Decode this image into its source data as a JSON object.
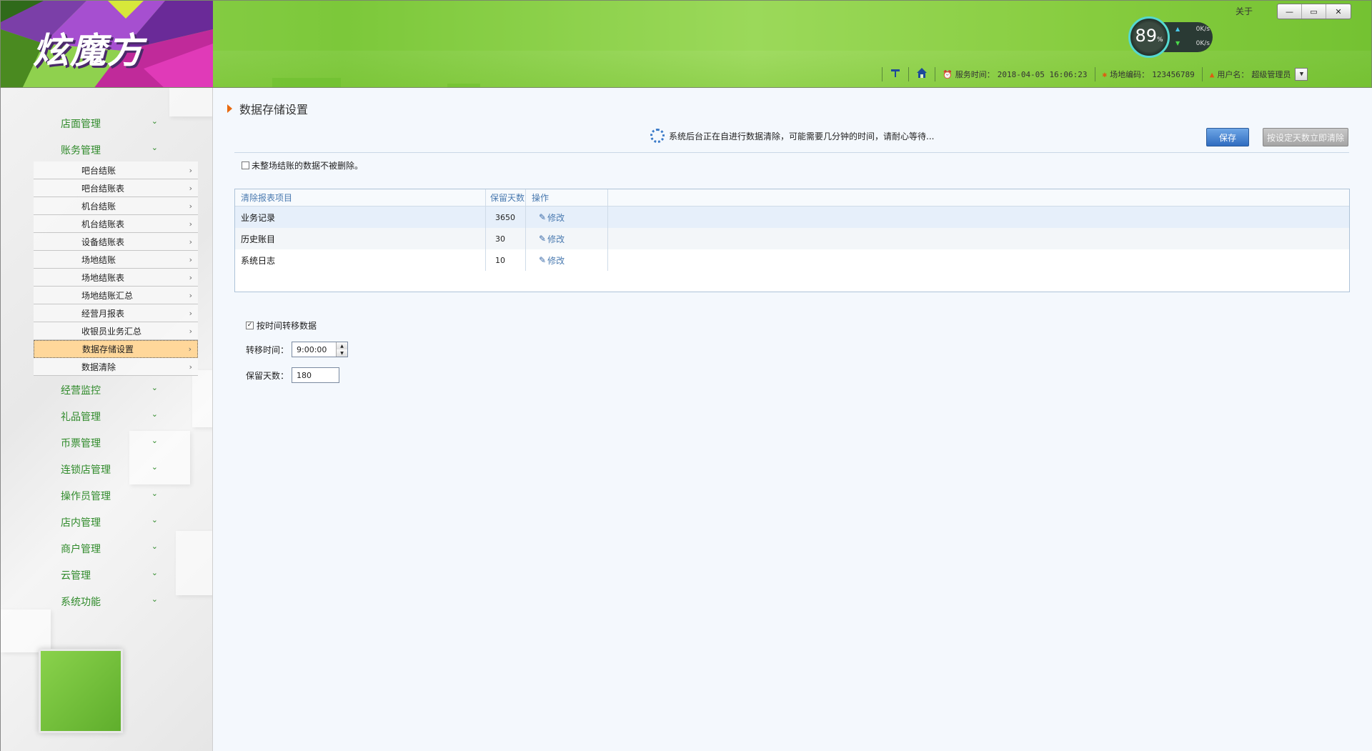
{
  "header": {
    "logo_text": "炫魔方",
    "about": "关于",
    "window_buttons": {
      "minimize": "—",
      "restore": "▭",
      "close": "✕"
    },
    "speed": {
      "percent": "89",
      "percent_unit": "%",
      "up": "0K/s",
      "down": "0K/s"
    },
    "status": {
      "server_time_label": "服务时间：",
      "server_time_value": "2018-04-05 16:06:23",
      "venue_code_label": "场地编码：",
      "venue_code_value": "123456789",
      "username_label": "用户名：",
      "username_value": "超级管理员"
    }
  },
  "sidebar": {
    "groups": [
      {
        "label": "店面管理"
      },
      {
        "label": "账务管理"
      },
      {
        "label": "经营监控"
      },
      {
        "label": "礼品管理"
      },
      {
        "label": "币票管理"
      },
      {
        "label": "连锁店管理"
      },
      {
        "label": "操作员管理"
      },
      {
        "label": "店内管理"
      },
      {
        "label": "商户管理"
      },
      {
        "label": "云管理"
      },
      {
        "label": "系统功能"
      }
    ],
    "sub_items": [
      {
        "label": "吧台结账"
      },
      {
        "label": "吧台结账表"
      },
      {
        "label": "机台结账"
      },
      {
        "label": "机台结账表"
      },
      {
        "label": "设备结账表"
      },
      {
        "label": "场地结账"
      },
      {
        "label": "场地结账表"
      },
      {
        "label": "场地结账汇总"
      },
      {
        "label": "经营月报表"
      },
      {
        "label": "收银员业务汇总"
      },
      {
        "label": "数据存储设置"
      },
      {
        "label": "数据清除"
      }
    ],
    "active_sub_item": "数据存储设置"
  },
  "main": {
    "title": "数据存储设置",
    "busy_message": "系统后台正在自进行数据清除，可能需要几分钟的时间，请耐心等待...",
    "save_button": "保存",
    "clear_now_button": "按设定天数立即清除",
    "keep_unsettled_label": "未整场结账的数据不被删除。",
    "keep_unsettled_checked": false,
    "grid": {
      "columns": [
        "清除报表项目",
        "保留天数",
        "操作"
      ],
      "rows": [
        {
          "item": "业务记录",
          "days": "3650",
          "action": "修改"
        },
        {
          "item": "历史账目",
          "days": "30",
          "action": "修改"
        },
        {
          "item": "系统日志",
          "days": "10",
          "action": "修改"
        }
      ]
    },
    "transfer_by_time_label": "按时间转移数据",
    "transfer_by_time_checked": true,
    "transfer_time_label": "转移时间：",
    "transfer_time_value": "9:00:00",
    "keep_days_label": "保留天数：",
    "keep_days_value": "180"
  },
  "colors": {
    "header_green": "#86cc3e",
    "nav_green": "#2f8a2a",
    "active_item": "#ffd79a",
    "save_blue": "#2f6cc0",
    "title_marker": "#e86a10"
  }
}
